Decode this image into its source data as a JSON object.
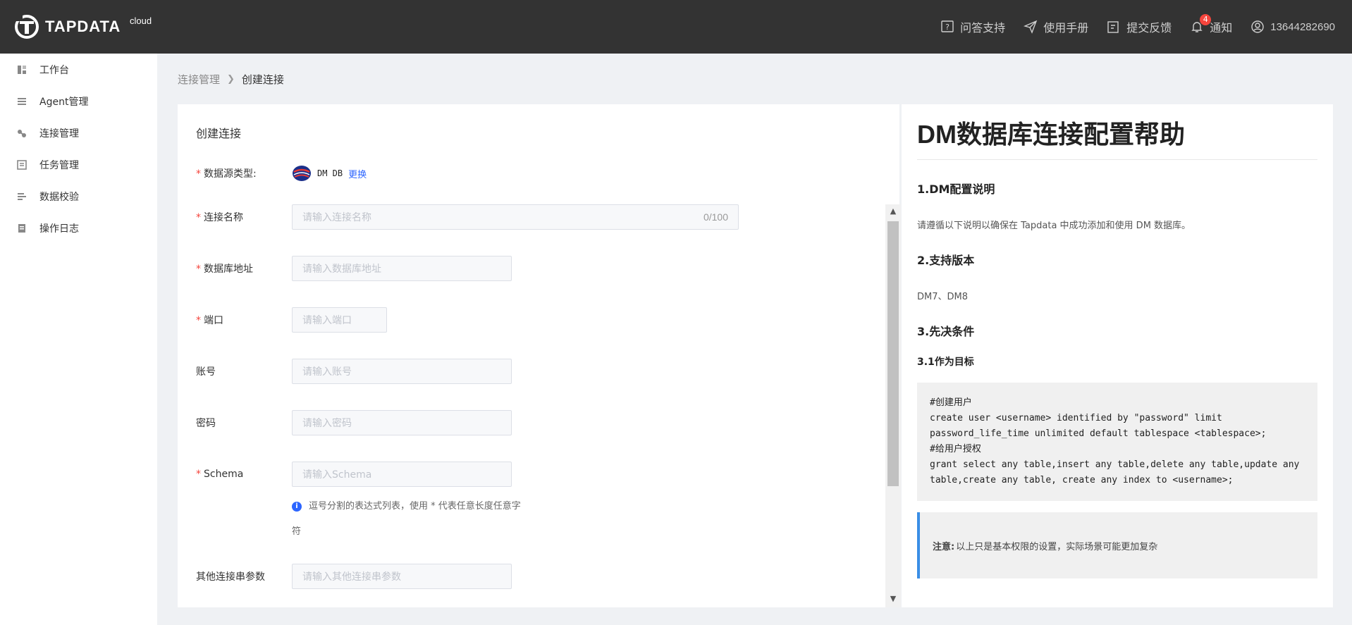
{
  "header": {
    "logo_text": "TAPDATA",
    "logo_sup": "cloud",
    "nav": [
      {
        "icon": "question-icon",
        "label": "问答支持"
      },
      {
        "icon": "paper-plane-icon",
        "label": "使用手册"
      },
      {
        "icon": "edit-icon",
        "label": "提交反馈"
      },
      {
        "icon": "bell-icon",
        "label": "通知",
        "badge": "4"
      },
      {
        "icon": "user-icon",
        "label": "13644282690"
      }
    ]
  },
  "sidebar": {
    "items": [
      {
        "icon": "dashboard-icon",
        "label": "工作台"
      },
      {
        "icon": "list-icon",
        "label": "Agent管理"
      },
      {
        "icon": "link-icon",
        "label": "连接管理"
      },
      {
        "icon": "task-icon",
        "label": "任务管理"
      },
      {
        "icon": "verify-icon",
        "label": "数据校验"
      },
      {
        "icon": "log-icon",
        "label": "操作日志"
      }
    ]
  },
  "breadcrumb": {
    "parent": "连接管理",
    "current": "创建连接"
  },
  "form": {
    "title": "创建连接",
    "datasource_label": "数据源类型:",
    "datasource_value": "DM DB",
    "change_label": "更换",
    "fields": {
      "name": {
        "label": "连接名称",
        "placeholder": "请输入连接名称",
        "counter": "0/100"
      },
      "host": {
        "label": "数据库地址",
        "placeholder": "请输入数据库地址"
      },
      "port": {
        "label": "端口",
        "placeholder": "请输入端口"
      },
      "account": {
        "label": "账号",
        "placeholder": "请输入账号"
      },
      "password": {
        "label": "密码",
        "placeholder": "请输入密码"
      },
      "schema": {
        "label": "Schema",
        "placeholder": "请输入Schema"
      },
      "extra": {
        "label": "其他连接串参数",
        "placeholder": "请输入其他连接串参数"
      }
    },
    "schema_hint": "逗号分割的表达式列表，使用 * 代表任意长度任意字符"
  },
  "help": {
    "title": "DM数据库连接配置帮助",
    "s1_title": "1.DM配置说明",
    "s1_text": "请遵循以下说明以确保在 Tapdata 中成功添加和使用 DM 数据库。",
    "s2_title": "2.支持版本",
    "s2_text": "DM7、DM8",
    "s3_title": "3.先决条件",
    "s31_title": "3.1作为目标",
    "code": "#创建用户\ncreate user <username> identified by \"password\" limit password_life_time unlimited default tablespace <tablespace>;\n#给用户授权\ngrant select any table,insert any table,delete any table,update any table,create any table, create any index to <username>;",
    "note_label": "注意:",
    "note_text": "以上只是基本权限的设置，实际场景可能更加复杂"
  }
}
